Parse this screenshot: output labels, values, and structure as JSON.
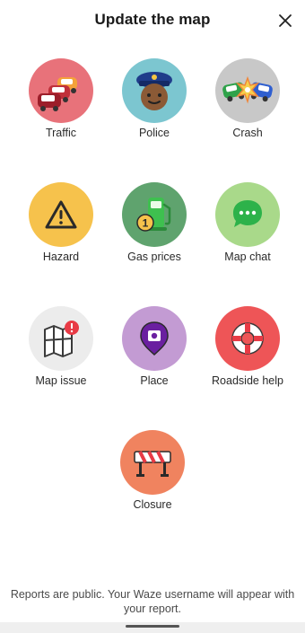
{
  "header": {
    "title": "Update the map",
    "close_icon": "close-icon"
  },
  "tiles": [
    {
      "id": "traffic",
      "label": "Traffic",
      "icon": "traffic-cars-icon",
      "color": "#e8727a"
    },
    {
      "id": "police",
      "label": "Police",
      "icon": "police-officer-icon",
      "color": "#7cc6d0"
    },
    {
      "id": "crash",
      "label": "Crash",
      "icon": "crash-icon",
      "color": "#c8c8c8"
    },
    {
      "id": "hazard",
      "label": "Hazard",
      "icon": "hazard-warning-icon",
      "color": "#f6c24c"
    },
    {
      "id": "gas",
      "label": "Gas prices",
      "icon": "gas-pump-icon",
      "color": "#5fa36e"
    },
    {
      "id": "mapchat",
      "label": "Map chat",
      "icon": "chat-bubble-icon",
      "color": "#a9d98a"
    },
    {
      "id": "mapissue",
      "label": "Map issue",
      "icon": "map-issue-icon",
      "color": "#ececec"
    },
    {
      "id": "place",
      "label": "Place",
      "icon": "place-pin-icon",
      "color": "#c39bd3"
    },
    {
      "id": "roadside",
      "label": "Roadside help",
      "icon": "lifebuoy-icon",
      "color": "#ee5557"
    },
    {
      "id": "closure",
      "label": "Closure",
      "icon": "road-barrier-icon",
      "color": "#f0835f"
    }
  ],
  "footer": {
    "note": "Reports are public. Your Waze username will appear with your report."
  }
}
